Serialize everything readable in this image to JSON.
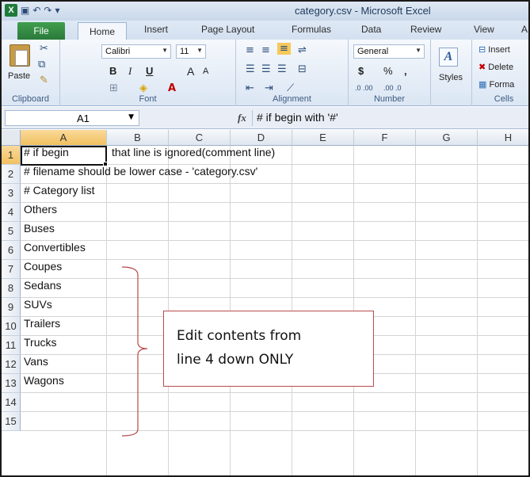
{
  "window": {
    "title": "category.csv - Microsoft Excel"
  },
  "tabs": {
    "file": "File",
    "home": "Home",
    "insert": "Insert",
    "page_layout": "Page Layout",
    "formulas": "Formulas",
    "data": "Data",
    "review": "Review",
    "view": "View",
    "overflow": "A"
  },
  "ribbon": {
    "clipboard": {
      "label": "Clipboard",
      "paste": "Paste"
    },
    "font": {
      "label": "Font",
      "name": "Calibri",
      "size": "11",
      "bold": "B",
      "italic": "I",
      "underline": "U",
      "grow": "A",
      "shrink": "A"
    },
    "alignment": {
      "label": "Alignment"
    },
    "number": {
      "label": "Number",
      "format": "General",
      "currency": "$",
      "percent": "%",
      "comma": ",",
      "inc_dec": ".0 .00",
      "dec_dec": ".00 .0"
    },
    "styles": {
      "label": "Styles"
    },
    "cells": {
      "label": "Cells",
      "insert": "Insert",
      "delete": "Delete",
      "format": "Forma"
    }
  },
  "formula_bar": {
    "name_box": "A1",
    "fx": "fx",
    "value": "# if begin with '#'"
  },
  "grid": {
    "columns": [
      "A",
      "B",
      "C",
      "D",
      "E",
      "F",
      "G",
      "H"
    ],
    "rows": [
      "1",
      "2",
      "3",
      "4",
      "5",
      "6",
      "7",
      "8",
      "9",
      "10",
      "11",
      "12",
      "13",
      "14",
      "15"
    ],
    "cells": [
      "# if begin",
      "# filename should be lower case - 'category.csv'",
      "# Category list",
      "Others",
      "Buses",
      "Convertibles",
      "Coupes",
      "Sedans",
      "SUVs",
      "Trailers",
      "Trucks",
      "Vans",
      "Wagons",
      "",
      ""
    ],
    "overflow_row1": "that line is ignored(comment line)"
  },
  "annotation": {
    "line1": "Edit contents from",
    "line2": "line 4 down ONLY",
    "color": "#b84a4a"
  }
}
